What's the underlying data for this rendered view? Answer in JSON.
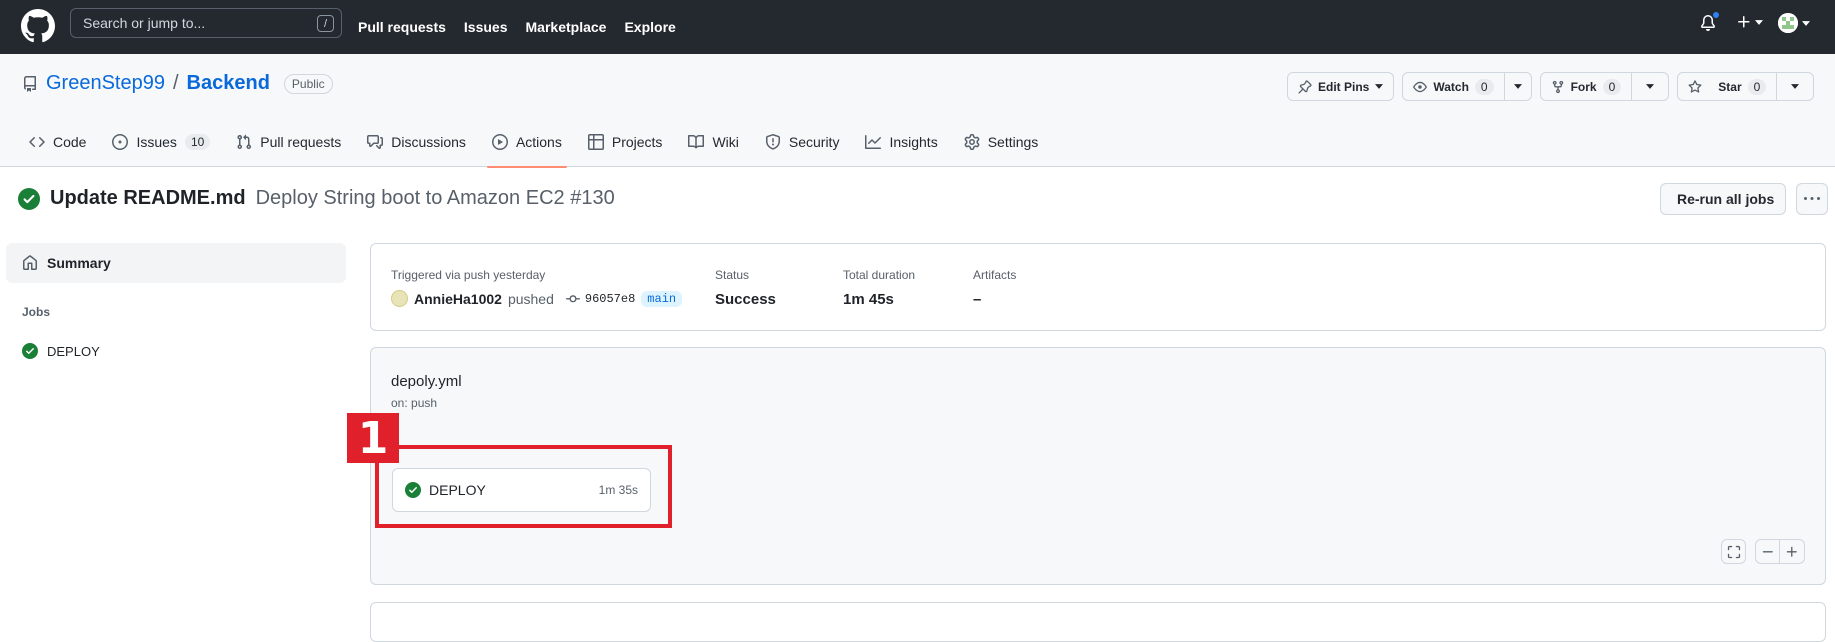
{
  "header": {
    "search_placeholder": "Search or jump to...",
    "search_key": "/",
    "nav": [
      "Pull requests",
      "Issues",
      "Marketplace",
      "Explore"
    ]
  },
  "repo": {
    "owner": "GreenStep99",
    "separator": "/",
    "name": "Backend",
    "visibility": "Public",
    "actions": {
      "edit_pins": "Edit Pins",
      "watch": "Watch",
      "watch_count": "0",
      "fork": "Fork",
      "fork_count": "0",
      "star": "Star",
      "star_count": "0"
    },
    "tabs": [
      {
        "label": "Code"
      },
      {
        "label": "Issues",
        "count": "10"
      },
      {
        "label": "Pull requests"
      },
      {
        "label": "Discussions"
      },
      {
        "label": "Actions"
      },
      {
        "label": "Projects"
      },
      {
        "label": "Wiki"
      },
      {
        "label": "Security"
      },
      {
        "label": "Insights"
      },
      {
        "label": "Settings"
      }
    ]
  },
  "run": {
    "commit_title": "Update README.md",
    "workflow_run": "Deploy String boot to Amazon EC2 #130",
    "rerun_label": "Re-run all jobs"
  },
  "sidebar": {
    "summary_label": "Summary",
    "jobs_heading": "Jobs",
    "jobs": [
      {
        "name": "DEPLOY"
      }
    ]
  },
  "summary": {
    "trigger_label": "Triggered via push yesterday",
    "user": "AnnieHa1002",
    "action": "pushed",
    "sha": "96057e8",
    "branch": "main",
    "status_label": "Status",
    "status_value": "Success",
    "duration_label": "Total duration",
    "duration_value": "1m 45s",
    "artifacts_label": "Artifacts",
    "artifacts_value": "–"
  },
  "graph": {
    "file": "depoly.yml",
    "trigger": "on: push",
    "job": {
      "name": "DEPLOY",
      "duration": "1m 35s"
    },
    "marker": "1"
  },
  "colors": {
    "header_bg": "#24292f",
    "link": "#0969da",
    "success": "#1a7f37",
    "active_tab_underline": "#fd8c73",
    "annotation": "#e0202a"
  }
}
